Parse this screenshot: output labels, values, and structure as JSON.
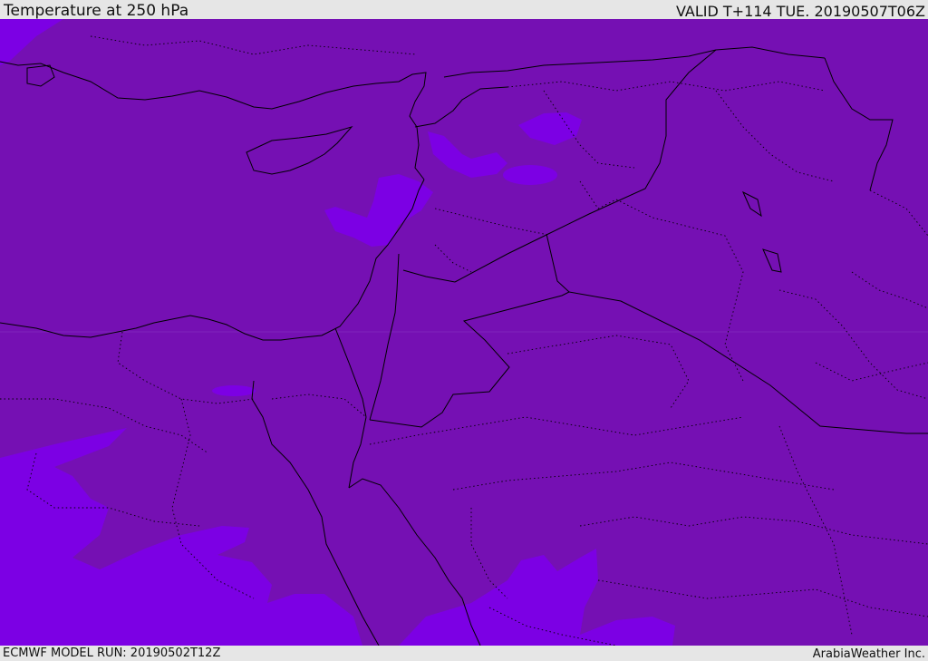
{
  "header": {
    "title": "Temperature at 250 hPa",
    "valid": "VALID T+114 TUE. 20190507T06Z"
  },
  "footer": {
    "model_run": "ECMWF MODEL RUN: 20190502T12Z",
    "credit": "ArabiaWeather Inc."
  },
  "colors": {
    "background_field": "#7510b3",
    "colder_field": "#7c00e4",
    "border_line": "#000000"
  }
}
